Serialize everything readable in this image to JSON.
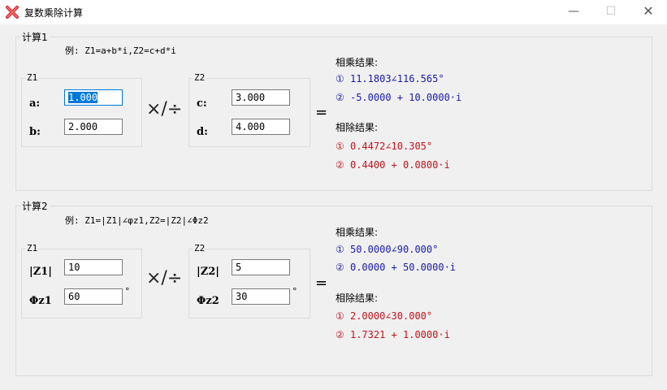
{
  "window": {
    "title": "复数乘除计算",
    "minimize": "—",
    "maximize": "☐",
    "close": "✕"
  },
  "calc1": {
    "label": "计算1",
    "example": "例: Z1=a+b*i,Z2=c+d*i",
    "z1": {
      "label": "Z1",
      "a_label": "a:",
      "a_value": "1.000",
      "b_label": "b:",
      "b_value": "2.000"
    },
    "operator": "×/÷",
    "z2": {
      "label": "Z2",
      "c_label": "c:",
      "c_value": "3.000",
      "d_label": "d:",
      "d_value": "4.000"
    },
    "equals": "=",
    "mul": {
      "title": "相乘结果:",
      "r1": "① 11.1803∠116.565°",
      "r2": "② -5.0000 + 10.0000·i"
    },
    "div": {
      "title": "相除结果:",
      "r1": "① 0.4472∠10.305°",
      "r2": "② 0.4400 + 0.0800·i"
    }
  },
  "calc2": {
    "label": "计算2",
    "example": "例: Z1=|Z1|∠φz1,Z2=|Z2|∠Φz2",
    "z1": {
      "label": "Z1",
      "mag_label": "|Z1|",
      "mag_value": "10",
      "ang_label": "Φz1",
      "ang_value": "60",
      "deg": "°"
    },
    "operator": "×/÷",
    "z2": {
      "label": "Z2",
      "mag_label": "|Z2|",
      "mag_value": "5",
      "ang_label": "Φz2",
      "ang_value": "30",
      "deg": "°"
    },
    "equals": "=",
    "mul": {
      "title": "相乘结果:",
      "r1": "① 50.0000∠90.000°",
      "r2": "② 0.0000 + 50.0000·i"
    },
    "div": {
      "title": "相除结果:",
      "r1": "① 2.0000∠30.000°",
      "r2": "② 1.7321 + 1.0000·i"
    }
  },
  "colors": {
    "multiply_result": "#1a1aa8",
    "divide_result": "#c0141c",
    "focus": "#0078d7"
  },
  "icons": {
    "app": "close-x-icon"
  }
}
